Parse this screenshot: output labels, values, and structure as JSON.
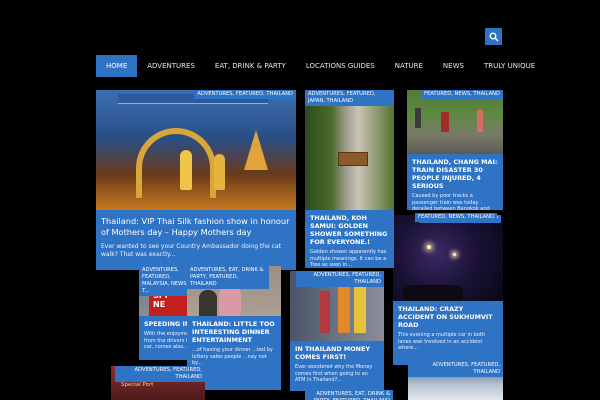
{
  "header": {
    "search_icon": "search-icon"
  },
  "nav": {
    "items": [
      {
        "label": "HOME",
        "active": true
      },
      {
        "label": "ADVENTURES"
      },
      {
        "label": "EAT, DRINK & PARTY"
      },
      {
        "label": "LOCATIONS GUIDES"
      },
      {
        "label": "NATURE"
      },
      {
        "label": "NEWS"
      },
      {
        "label": "TRULY UNIQUE"
      }
    ]
  },
  "cards": {
    "silk": {
      "tags": "ADVENTURES, FEATURED, THAILAND",
      "title": "Thailand: VIP Thai Silk fashion show in honour of Mothers day – Happy Mothers day",
      "excerpt": "Ever wanted to see your Country Ambassador doing the cat walk? That was exactly..."
    },
    "samui": {
      "tags": "ADVENTURES, FEATURED, JAPAN, THAILAND",
      "title": "THAILAND, KOH SAMUI: GOLDEN SHOWER SOMETHING FOR EVERYONE.!",
      "excerpt": "Golden shower apparently has multiple meanings. It can be a Tree as seen in..."
    },
    "train": {
      "tags": "FEATURED, NEWS, THAILAND",
      "title": "THAILAND, CHANG MAI: TRAIN DISASTER 30 PEOPLE INJURED, 4 SERIOUS",
      "excerpt": "Caused by poor tracks a passenger train was today derailed between Bangkok and Chang..."
    },
    "speeding": {
      "tags": "ADVENTURES, FEATURED, MALAYSIA, NEWS, T...",
      "title": "SPEEDING IN",
      "excerpt": "With the enjoymen from the drivers in car, comes also..."
    },
    "dinner": {
      "tags": "ADVENTURES, EAT, DRINK & PARTY, FEATURED, THAILAND",
      "title": "THAILAND: LITTLE TOO INTERESTING DINNER ENTERTAINMENT",
      "excerpt": "...of having your dinner ...ted by lottery sales people ...nay not by..."
    },
    "atm": {
      "tags": "ADVENTURES, FEATURED, THAILAND",
      "title": "IN THAILAND MONEY COMES FIRST!",
      "excerpt": "Ever wondered why the Money comes first when going to an ATM in Thailand?..."
    },
    "crazy": {
      "tags": "FEATURED, NEWS, THAILAND",
      "title": "THAILAND: CRAZY ACCIDENT ON SUKHUMVIT ROAD",
      "excerpt": "This evening a multiple car in both lanes was Involved in an accident where..."
    }
  },
  "bottom_tags": {
    "left": "ADVENTURES, FEATURED, THAILAND",
    "middle": "ADVENTURES, EAT, DRINK & PARTY, FEATURED, THAILAND",
    "right": "ADVENTURES, FEATURED, THAILAND"
  },
  "scene_text": {
    "sign": "RED\nSPI\nNE",
    "banner": "Special Port"
  },
  "colors": {
    "accent": "#2f73c5",
    "background": "#000000"
  }
}
